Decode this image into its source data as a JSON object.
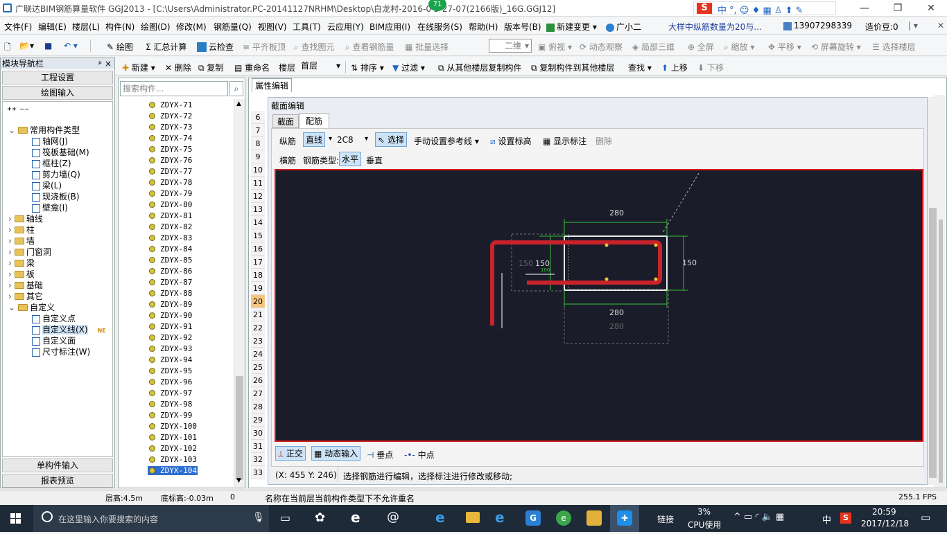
{
  "window": {
    "title": "广联达BIM钢筋算量软件 GGJ2013 - [C:\\Users\\Administrator.PC-20141127NRHM\\Desktop\\白龙村-2016-0  3-27-07(2166版)_16G.GGJ12]",
    "badge": "71",
    "controls": [
      "—",
      "❐",
      "✕"
    ]
  },
  "menu": [
    "文件(F)",
    "编辑(E)",
    "楼层(L)",
    "构件(N)",
    "绘图(D)",
    "修改(M)",
    "钢筋量(Q)",
    "视图(V)",
    "工具(T)",
    "云应用(Y)",
    "BIM应用(I)",
    "在线服务(S)",
    "帮助(H)",
    "版本号(B)",
    "新建变更 ▾",
    "广小二"
  ],
  "menu_right": {
    "notice": "大样中纵筋数量为20与...",
    "phone": "13907298339",
    "coins": "造价豆:0"
  },
  "toolbar1": {
    "items": [
      "绘图",
      "汇总计算",
      "云检查",
      "平齐板顶",
      "查找图元",
      "查看钢筋量",
      "批量选择"
    ],
    "view_select": "二维",
    "items2": [
      "俯视",
      "动态观察",
      "局部三维",
      "全屏",
      "缩放",
      "平移",
      "屏幕旋转",
      "选择楼层"
    ]
  },
  "toolbar2": {
    "items": [
      "新建",
      "删除",
      "复制",
      "重命名"
    ],
    "floor_label": "楼层",
    "floor_value": "首层",
    "items2": [
      "排序",
      "过滤",
      "从其他楼层复制构件",
      "复制构件到其他楼层",
      "查找",
      "上移",
      "下移"
    ]
  },
  "nav": {
    "header": "模块导航栏",
    "pin": "ᵖ ×",
    "top_buttons": [
      "工程设置",
      "绘图输入"
    ],
    "bottom_buttons": [
      "单构件输入",
      "报表预览"
    ],
    "tree": [
      {
        "label": "常用构件类型",
        "level": 0,
        "folder": true,
        "exp": "⌄"
      },
      {
        "label": "轴网(J)",
        "level": 1
      },
      {
        "label": "筏板基础(M)",
        "level": 1
      },
      {
        "label": "框柱(Z)",
        "level": 1
      },
      {
        "label": "剪力墙(Q)",
        "level": 1
      },
      {
        "label": "梁(L)",
        "level": 1
      },
      {
        "label": "现浇板(B)",
        "level": 1
      },
      {
        "label": "壁龛(I)",
        "level": 1
      },
      {
        "label": "轴线",
        "level": 0,
        "folder": true,
        "exp": "›"
      },
      {
        "label": "柱",
        "level": 0,
        "folder": true,
        "exp": "›"
      },
      {
        "label": "墙",
        "level": 0,
        "folder": true,
        "exp": "›"
      },
      {
        "label": "门窗洞",
        "level": 0,
        "folder": true,
        "exp": "›"
      },
      {
        "label": "梁",
        "level": 0,
        "folder": true,
        "exp": "›"
      },
      {
        "label": "板",
        "level": 0,
        "folder": true,
        "exp": "›"
      },
      {
        "label": "基础",
        "level": 0,
        "folder": true,
        "exp": "›"
      },
      {
        "label": "其它",
        "level": 0,
        "folder": true,
        "exp": "›"
      },
      {
        "label": "自定义",
        "level": 0,
        "folder": true,
        "exp": "⌄"
      },
      {
        "label": "自定义点",
        "level": 1
      },
      {
        "label": "自定义线(X)",
        "level": 1,
        "new": "NE"
      },
      {
        "label": "自定义面",
        "level": 1
      },
      {
        "label": "尺寸标注(W)",
        "level": 1
      }
    ]
  },
  "list": {
    "search_placeholder": "搜索构件...",
    "items": [
      "ZDYX-71",
      "ZDYX-72",
      "ZDYX-73",
      "ZDYX-74",
      "ZDYX-75",
      "ZDYX-76",
      "ZDYX-77",
      "ZDYX-78",
      "ZDYX-79",
      "ZDYX-80",
      "ZDYX-81",
      "ZDYX-82",
      "ZDYX-83",
      "ZDYX-84",
      "ZDYX-85",
      "ZDYX-86",
      "ZDYX-87",
      "ZDYX-88",
      "ZDYX-89",
      "ZDYX-90",
      "ZDYX-91",
      "ZDYX-92",
      "ZDYX-93",
      "ZDYX-94",
      "ZDYX-95",
      "ZDYX-96",
      "ZDYX-97",
      "ZDYX-98",
      "ZDYX-99",
      "ZDYX-100",
      "ZDYX-101",
      "ZDYX-102",
      "ZDYX-103",
      "ZDYX-104"
    ],
    "selected": "ZDYX-104"
  },
  "prop": {
    "tab": "属性编辑",
    "rows": [
      "6",
      "7",
      "8",
      "9",
      "10",
      "11",
      "12",
      "13",
      "14",
      "15",
      "16",
      "17",
      "18",
      "19",
      "20",
      "21",
      "22",
      "23",
      "24",
      "25",
      "26",
      "27",
      "28",
      "29",
      "30",
      "31",
      "32",
      "33"
    ],
    "active_row": "20"
  },
  "dialog": {
    "title": "截面编辑",
    "tabs": [
      "截面",
      "配筋"
    ],
    "active_tab": "配筋",
    "row1": {
      "label": "纵筋",
      "mode": "直线",
      "spec": "2C8",
      "select": "选择",
      "ref": "手动设置参考线",
      "set_elev": "设置标高",
      "show_dim": "显示标注",
      "delete": "删除"
    },
    "row2": {
      "label": "横筋",
      "type_label": "钢筋类型:",
      "horizontal": "水平",
      "vertical": "垂直"
    },
    "dims": {
      "top": "280",
      "bottom": "280",
      "bottom_ghost": "280",
      "right": "150",
      "left": "150",
      "left_ghost": "150",
      "small": "100"
    },
    "bottom_bar": {
      "ortho": "正交",
      "dyn": "动态输入",
      "perp": "垂点",
      "mid": "中点"
    },
    "status": {
      "coords": "(X: 455 Y: 246)",
      "hint": "选择钢筋进行编辑，选择标注进行修改或移动;"
    }
  },
  "statusbar": {
    "floor_h": "层高:4.5m",
    "base_h": "底标高:-0.03m",
    "num": "0",
    "msg": "名称在当前层当前构件类型下不允许重名",
    "fps": "255.1 FPS"
  },
  "taskbar": {
    "search": "在这里输入你要搜索的内容",
    "link": "链接",
    "cpu": "3%",
    "cpu_label": "CPU使用",
    "ime": "中",
    "time": "20:59",
    "date": "2017/12/18"
  },
  "colors": {
    "rebar": "#c8232a",
    "canvas": "#1b1c2a",
    "dim": "#35c23a",
    "accent": "#0078d7"
  }
}
